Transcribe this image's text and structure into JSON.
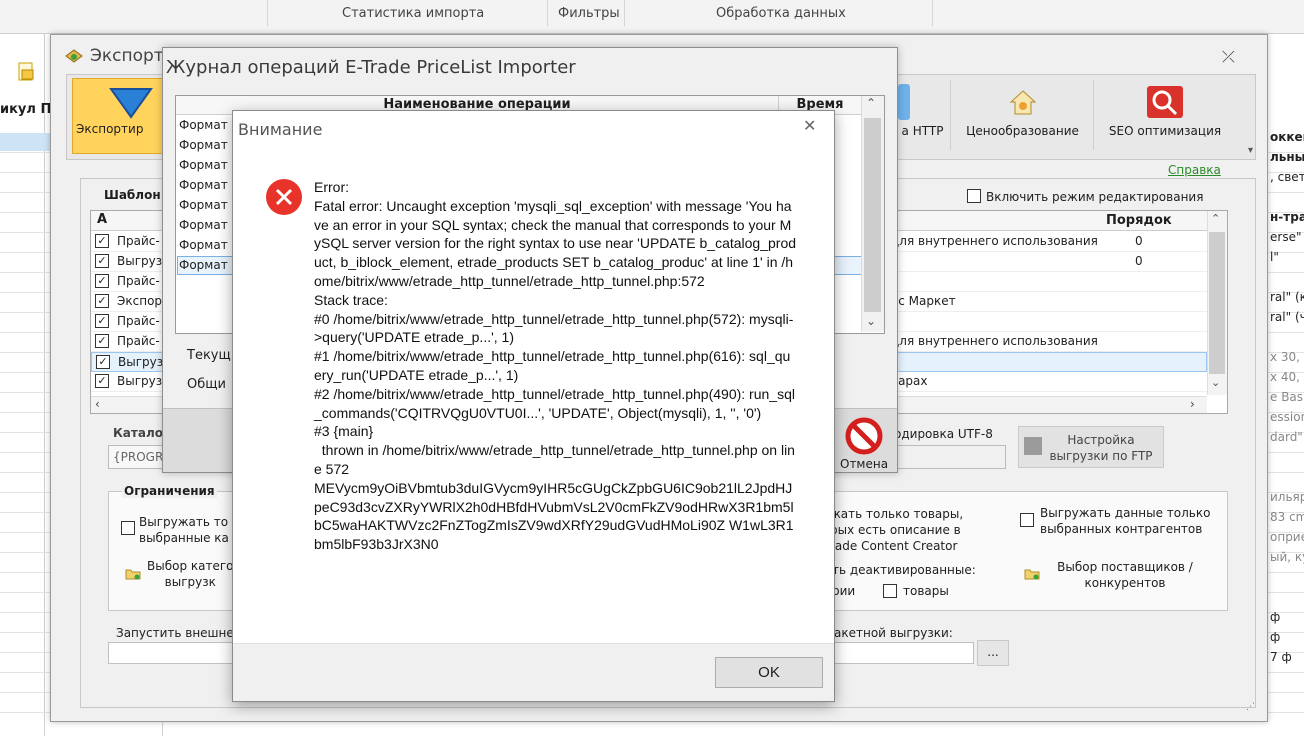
{
  "background_app": {
    "ribbon_groups": [
      "Статистика импорта",
      "Фильтры",
      "Обработка данных"
    ],
    "left_header_text": "икул  П",
    "right_cells": [
      "оккен",
      "льны",
      ", свет",
      "",
      "н-тра",
      "erse\"",
      "l\"",
      "",
      "ral\" (к",
      "ral\" (ч",
      "",
      "x 30,",
      "x 40,",
      "e Bas",
      "ession",
      "dard\"",
      "",
      "",
      "ильяр",
      "83 cm",
      "оприе",
      "ый, ку",
      "",
      "",
      "ф",
      "ф",
      "7 ф"
    ]
  },
  "export_window": {
    "title": "Экспорт",
    "close_icon": "close-icon",
    "ribbon": {
      "export_label": "Экспортир",
      "http_label": "а HTTP",
      "pricing_label": "Ценообразование",
      "seo_label": "SEO оптимизация"
    },
    "help_link": "Справка",
    "templates_label": "Шаблон",
    "edit_mode_label": "Включить режим редактирования",
    "table": {
      "col_a": "A",
      "col_order": "Порядок",
      "rows": [
        {
          "label": "Прайс-",
          "right": "для внутреннего использования",
          "order": "0"
        },
        {
          "label": "Выгруз",
          "right": "",
          "order": "0"
        },
        {
          "label": "Прайс-",
          "right": "",
          "order": ""
        },
        {
          "label": "Экспор",
          "right": "кс Маркет",
          "order": ""
        },
        {
          "label": "Прайс-",
          "right": "",
          "order": ""
        },
        {
          "label": "Прайс-",
          "right": "для внутреннего использования",
          "order": ""
        },
        {
          "label": "Выгруз",
          "right": "",
          "order": ""
        },
        {
          "label": "Выгруз",
          "right": "варах",
          "order": ""
        }
      ]
    },
    "catalog_label": "Катало",
    "catalog_value": "{PROGR",
    "encoding_label": "одировка UTF-8",
    "ftp_button": "Настройка выгрузки по FTP",
    "limits": {
      "title": "Ограничения",
      "only_selected_line1": "Выгружать то",
      "only_selected_line2": "выбранные ка",
      "category_select_line1": "Выбор катего",
      "category_select_line2": "выгрузк",
      "desc_line1": "жать только товары,",
      "desc_line2": "рых есть описание в",
      "desc_line3": "rade Content Creator",
      "deactivated": "ть деактивированные:",
      "categories": "рии",
      "goods": "товары",
      "contractors_line1": "Выгружать данные только",
      "contractors_line2": "выбранных контрагентов",
      "suppliers_line1": "Выбор поставщиков /",
      "suppliers_line2": "конкурентов"
    },
    "external_label": "Запустить внешне",
    "batch_label": "акетной выгрузки:",
    "browse_button": "..."
  },
  "journal_window": {
    "title": "Журнал операций E-Trade PriceList Importer",
    "col_name": "Наименование операции",
    "col_time": "Время",
    "rows": [
      "Формат",
      "Формат",
      "Формат",
      "Формат",
      "Формат",
      "Формат",
      "Формат",
      "Формат"
    ],
    "current_label": "Текущ",
    "total_label": "Общи",
    "cancel_label": "Отмена"
  },
  "alert": {
    "title": "Внимание",
    "icon": "error-icon",
    "message": "Error:\nFatal error: Uncaught exception 'mysqli_sql_exception' with message 'You have an error in your SQL syntax; check the manual that corresponds to your MySQL server version for the right syntax to use near 'UPDATE b_catalog_product, b_iblock_element, etrade_products SET b_catalog_produc' at line 1' in /home/bitrix/www/etrade_http_tunnel/etrade_http_tunnel.php:572\nStack trace:\n#0 /home/bitrix/www/etrade_http_tunnel/etrade_http_tunnel.php(572): mysqli->query('UPDATE etrade_p...', 1)\n#1 /home/bitrix/www/etrade_http_tunnel/etrade_http_tunnel.php(616): sql_query_run('UPDATE etrade_p...', 1)\n#2 /home/bitrix/www/etrade_http_tunnel/etrade_http_tunnel.php(490): run_sql_commands('CQITRVQgU0VTU0I...', 'UPDATE', Object(mysqli), 1, '', '0')\n#3 {main}\n  thrown in /home/bitrix/www/etrade_http_tunnel/etrade_http_tunnel.php on line 572\nMEVycm9yOiBVbmtub3duIGVycm9yIHR5cGUgCkZpbGU6IC9ob21lL2JpdHJpeC93d3cvZXRyYWRlX2h0dHBfdHVubmVsL2V0cmFkZV9odHRwX3R1bm5lbC5waHAKTWVzc2FnZTogZmIsZV9wdXRfY29udGVudHMoLi90Z W1wL3R1bm5lbF93b3JrX3N0",
    "ok_button": "OK"
  }
}
